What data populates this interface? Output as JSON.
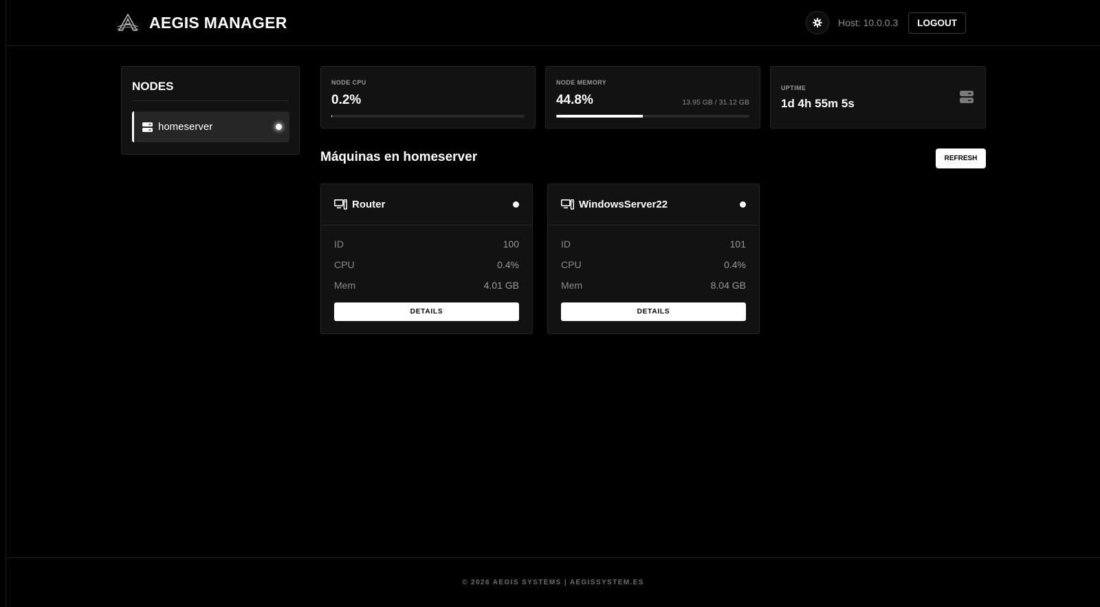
{
  "header": {
    "title": "AEGIS MANAGER",
    "host_label": "Host: 10.0.0.3",
    "logout_label": "LOGOUT",
    "logo_icon": "aegis-logo",
    "theme_icon": "gear-icon"
  },
  "sidebar": {
    "title": "NODES",
    "items": [
      {
        "label": "homeserver",
        "icon": "server-icon",
        "status": "online"
      }
    ]
  },
  "stats": {
    "cpu": {
      "label": "NODE CPU",
      "value": "0.2%",
      "fraction": 0.002
    },
    "memory": {
      "label": "NODE MEMORY",
      "value": "44.8%",
      "detail": "13.95 GB / 31.12 GB",
      "fraction": 0.448
    },
    "uptime": {
      "label": "UPTIME",
      "value": "1d 4h 55m 5s",
      "icon": "server-icon"
    }
  },
  "machines": {
    "title": "Máquinas en homeserver",
    "refresh_label": "REFRESH",
    "items": [
      {
        "name": "Router",
        "icon": "vm-icon",
        "status": "running",
        "rows": [
          {
            "key": "ID",
            "value": "100"
          },
          {
            "key": "CPU",
            "value": "0.4%"
          },
          {
            "key": "Mem",
            "value": "4.01 GB"
          }
        ],
        "details_label": "DETAILS"
      },
      {
        "name": "WindowsServer22",
        "icon": "vm-icon",
        "status": "running",
        "rows": [
          {
            "key": "ID",
            "value": "101"
          },
          {
            "key": "CPU",
            "value": "0.4%"
          },
          {
            "key": "Mem",
            "value": "8.04 GB"
          }
        ],
        "details_label": "DETAILS"
      }
    ]
  },
  "footer": {
    "text": "© 2026 AEGIS SYSTEMS | AEGISSYSTEM.ES"
  },
  "colors": {
    "background": "#000000",
    "card": "#121212",
    "accent": "#ffffff",
    "muted": "#8a8a8a"
  }
}
